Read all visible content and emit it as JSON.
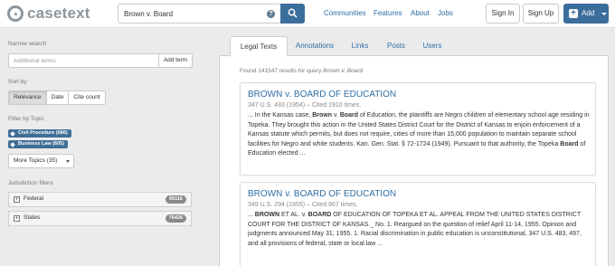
{
  "header": {
    "logo_text": "casetext",
    "search_value": "Brown v. Board",
    "help_glyph": "?",
    "nav": [
      "Communities",
      "Features",
      "About",
      "Jobs"
    ],
    "sign_in": "Sign In",
    "sign_up": "Sign Up",
    "add_label": "Add",
    "add_glyph": "+"
  },
  "sidebar": {
    "narrow_label": "Narrow search",
    "terms_placeholder": "Additional terms",
    "add_term": "Add term",
    "sort_label": "Sort by",
    "sort_options": [
      "Relevance",
      "Date",
      "Cite count"
    ],
    "sort_selected": "Relevance",
    "topic_label": "Filter by Topic",
    "topics": [
      "Civil Procedure (686)",
      "Business Law (605)"
    ],
    "more_topics": "More Topics (35)",
    "jurisdiction_label": "Jurisdiction filters",
    "jurisdictions": [
      {
        "name": "Federal",
        "count": "65116"
      },
      {
        "name": "States",
        "count": "76426"
      }
    ],
    "expand_glyph": "+"
  },
  "tabs": [
    "Legal Texts",
    "Annotations",
    "Links",
    "Posts",
    "Users"
  ],
  "active_tab": "Legal Texts",
  "results": {
    "found_prefix": "Found 141547 results for query",
    "query": "Brown v. Board",
    "items": [
      {
        "title": "BROWN v. BOARD OF EDUCATION",
        "cite": "347 U.S. 483 (1954) – Cited 1910 times.",
        "snippet": [
          {
            "t": "... In the Kansas case, ",
            "b": false
          },
          {
            "t": "Brown",
            "b": true
          },
          {
            "t": " v. ",
            "b": false
          },
          {
            "t": "Board",
            "b": true
          },
          {
            "t": " of Education, the plaintiffs are Negro children of elementary school age residing in Topeka. They brought this action in the United States District Court for the District of Kansas to enjoin enforcement of a Kansas statute which permits, but does not require, cities of more than 15,000 population to maintain separate school facilities for Negro and white students. Kan. Gen. Stat. § 72-1724 (1949). Pursuant to that authority, the Topeka ",
            "b": false
          },
          {
            "t": "Board",
            "b": true
          },
          {
            "t": " of Education elected ...",
            "b": false
          }
        ]
      },
      {
        "title": "BROWN v. BOARD OF EDUCATION",
        "cite": "349 U.S. 294 (1955) – Cited 867 times.",
        "snippet": [
          {
            "t": "... ",
            "b": false
          },
          {
            "t": "BROWN",
            "b": true
          },
          {
            "t": " ET AL. v. ",
            "b": false
          },
          {
            "t": "BOARD",
            "b": true
          },
          {
            "t": " OF EDUCATION OF TOPEKA ET AL. APPEAL FROM THE UNITED STATES DISTRICT COURT FOR THE DISTRICT OF KANSAS._ No. 1. Reargued on the question of relief April 11-14, 1955. Opinion and judgments announced May 31, 1955. 1. Racial discrimination in public education is unconstitutional, 347 U.S. 483, 497, and all provisions of federal, state or local law ...",
            "b": false
          }
        ]
      }
    ]
  },
  "colors": {
    "brand_blue": "#3c6e9c",
    "link_blue": "#2f6fa5",
    "tag_blue": "#3f6e97",
    "background": "#ebebeb"
  }
}
